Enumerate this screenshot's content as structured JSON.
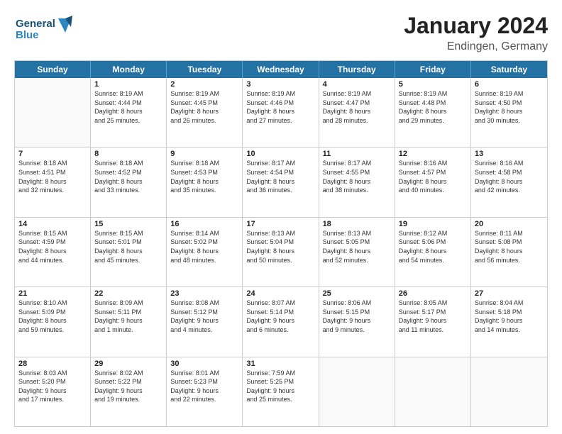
{
  "header": {
    "logo_line1": "General",
    "logo_line2": "Blue",
    "title": "January 2024",
    "subtitle": "Endingen, Germany"
  },
  "days_of_week": [
    "Sunday",
    "Monday",
    "Tuesday",
    "Wednesday",
    "Thursday",
    "Friday",
    "Saturday"
  ],
  "weeks": [
    [
      {
        "day": "",
        "info": ""
      },
      {
        "day": "1",
        "info": "Sunrise: 8:19 AM\nSunset: 4:44 PM\nDaylight: 8 hours\nand 25 minutes."
      },
      {
        "day": "2",
        "info": "Sunrise: 8:19 AM\nSunset: 4:45 PM\nDaylight: 8 hours\nand 26 minutes."
      },
      {
        "day": "3",
        "info": "Sunrise: 8:19 AM\nSunset: 4:46 PM\nDaylight: 8 hours\nand 27 minutes."
      },
      {
        "day": "4",
        "info": "Sunrise: 8:19 AM\nSunset: 4:47 PM\nDaylight: 8 hours\nand 28 minutes."
      },
      {
        "day": "5",
        "info": "Sunrise: 8:19 AM\nSunset: 4:48 PM\nDaylight: 8 hours\nand 29 minutes."
      },
      {
        "day": "6",
        "info": "Sunrise: 8:19 AM\nSunset: 4:50 PM\nDaylight: 8 hours\nand 30 minutes."
      }
    ],
    [
      {
        "day": "7",
        "info": "Sunrise: 8:18 AM\nSunset: 4:51 PM\nDaylight: 8 hours\nand 32 minutes."
      },
      {
        "day": "8",
        "info": "Sunrise: 8:18 AM\nSunset: 4:52 PM\nDaylight: 8 hours\nand 33 minutes."
      },
      {
        "day": "9",
        "info": "Sunrise: 8:18 AM\nSunset: 4:53 PM\nDaylight: 8 hours\nand 35 minutes."
      },
      {
        "day": "10",
        "info": "Sunrise: 8:17 AM\nSunset: 4:54 PM\nDaylight: 8 hours\nand 36 minutes."
      },
      {
        "day": "11",
        "info": "Sunrise: 8:17 AM\nSunset: 4:55 PM\nDaylight: 8 hours\nand 38 minutes."
      },
      {
        "day": "12",
        "info": "Sunrise: 8:16 AM\nSunset: 4:57 PM\nDaylight: 8 hours\nand 40 minutes."
      },
      {
        "day": "13",
        "info": "Sunrise: 8:16 AM\nSunset: 4:58 PM\nDaylight: 8 hours\nand 42 minutes."
      }
    ],
    [
      {
        "day": "14",
        "info": "Sunrise: 8:15 AM\nSunset: 4:59 PM\nDaylight: 8 hours\nand 44 minutes."
      },
      {
        "day": "15",
        "info": "Sunrise: 8:15 AM\nSunset: 5:01 PM\nDaylight: 8 hours\nand 45 minutes."
      },
      {
        "day": "16",
        "info": "Sunrise: 8:14 AM\nSunset: 5:02 PM\nDaylight: 8 hours\nand 48 minutes."
      },
      {
        "day": "17",
        "info": "Sunrise: 8:13 AM\nSunset: 5:04 PM\nDaylight: 8 hours\nand 50 minutes."
      },
      {
        "day": "18",
        "info": "Sunrise: 8:13 AM\nSunset: 5:05 PM\nDaylight: 8 hours\nand 52 minutes."
      },
      {
        "day": "19",
        "info": "Sunrise: 8:12 AM\nSunset: 5:06 PM\nDaylight: 8 hours\nand 54 minutes."
      },
      {
        "day": "20",
        "info": "Sunrise: 8:11 AM\nSunset: 5:08 PM\nDaylight: 8 hours\nand 56 minutes."
      }
    ],
    [
      {
        "day": "21",
        "info": "Sunrise: 8:10 AM\nSunset: 5:09 PM\nDaylight: 8 hours\nand 59 minutes."
      },
      {
        "day": "22",
        "info": "Sunrise: 8:09 AM\nSunset: 5:11 PM\nDaylight: 9 hours\nand 1 minute."
      },
      {
        "day": "23",
        "info": "Sunrise: 8:08 AM\nSunset: 5:12 PM\nDaylight: 9 hours\nand 4 minutes."
      },
      {
        "day": "24",
        "info": "Sunrise: 8:07 AM\nSunset: 5:14 PM\nDaylight: 9 hours\nand 6 minutes."
      },
      {
        "day": "25",
        "info": "Sunrise: 8:06 AM\nSunset: 5:15 PM\nDaylight: 9 hours\nand 9 minutes."
      },
      {
        "day": "26",
        "info": "Sunrise: 8:05 AM\nSunset: 5:17 PM\nDaylight: 9 hours\nand 11 minutes."
      },
      {
        "day": "27",
        "info": "Sunrise: 8:04 AM\nSunset: 5:18 PM\nDaylight: 9 hours\nand 14 minutes."
      }
    ],
    [
      {
        "day": "28",
        "info": "Sunrise: 8:03 AM\nSunset: 5:20 PM\nDaylight: 9 hours\nand 17 minutes."
      },
      {
        "day": "29",
        "info": "Sunrise: 8:02 AM\nSunset: 5:22 PM\nDaylight: 9 hours\nand 19 minutes."
      },
      {
        "day": "30",
        "info": "Sunrise: 8:01 AM\nSunset: 5:23 PM\nDaylight: 9 hours\nand 22 minutes."
      },
      {
        "day": "31",
        "info": "Sunrise: 7:59 AM\nSunset: 5:25 PM\nDaylight: 9 hours\nand 25 minutes."
      },
      {
        "day": "",
        "info": ""
      },
      {
        "day": "",
        "info": ""
      },
      {
        "day": "",
        "info": ""
      }
    ]
  ]
}
